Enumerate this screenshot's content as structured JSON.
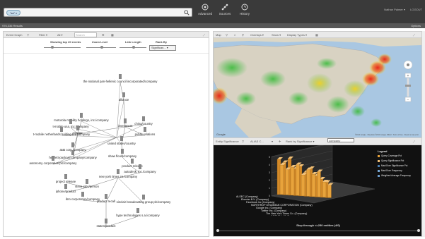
{
  "topbar": {
    "search_token": "\"sa\" x",
    "tools": [
      {
        "label": "Advanced",
        "icon": "gear-icon"
      },
      {
        "label": "Sources",
        "icon": "sources-icon"
      },
      {
        "label": "History",
        "icon": "history-icon"
      }
    ],
    "user_name": "Nathan Palmer ▾",
    "user_extra": "LOGOUT"
  },
  "subbar": {
    "results": "976,336 Results",
    "options": "Options"
  },
  "graph_panel": {
    "title": "Event Graph",
    "filter_label": "Filter ▾",
    "all_label": "All ▾",
    "search_placeholder": "Search",
    "showing_label": "Showing top 20 events",
    "zoom_label": "Zoom Level",
    "link_label": "Link Length",
    "rank_label": "Rank By",
    "rank_value": "Significan... ▾",
    "nodes": [
      "the national pan-hellenic council incorporated/company",
      "alliance",
      "motorola mobility holdings, inc./company",
      "t-mobile usa, inc./company",
      "t-mobile netherlands holding b.v./company",
      "china/country",
      "public relations",
      "united states/country",
      "at&t corp./company",
      "hewlett-packard company/company",
      "autonomy corporation plc/company",
      "shaw floors/company",
      "product release",
      "autodesk, inc./company",
      "project release",
      "iphone/product",
      "steve jobs/person",
      "ibm corporation/company",
      "product recall",
      "sinclair broadcasting group plc/company",
      "hype technologies s.a./company",
      "states/product",
      "new york times co./company",
      "merger",
      "investment"
    ]
  },
  "map_panel": {
    "title": "Map",
    "overlays": "Overlays ▾",
    "show": "Show ▾",
    "display_types": "Display Types ▾",
    "attribution": "©2014 Google · Map data ©2014 Google, INEGI · Terms of Use · Report a map error"
  },
  "chart_panel": {
    "title": "Entity Significance",
    "alias": "ALIAS C...",
    "rank_by": "Rank by Significance ▾",
    "company_input": "company",
    "step_text": "Step through <=250 entities (4/0)",
    "legend_title": "Legend",
    "legend": [
      {
        "label": "Query Coverage Pct",
        "color": "#e8a33b"
      },
      {
        "label": "Query Significance Pct",
        "color": "#f0c078"
      },
      {
        "label": "Max/Over Significance Pct",
        "color": "#4a7fb5"
      },
      {
        "label": "Max/Over Frequency",
        "color": "#7aa9d6"
      },
      {
        "label": "Weighted Average Frequency",
        "color": "#6d9ecf"
      }
    ],
    "entities": [
      "ALSEC (Company)",
      "Elsevier B.V. (Company)",
      "Facebook Inc (Company)",
      "NORTHROP GRUMMAN CORPORATION (Company)",
      "Google Inc. (Company)",
      "Twitter Inc. (Company)",
      "The New York Times Co. (Company)",
      "WEBMD LLC (Company)",
      "Apple Inc. (Company)",
      "THE BOEING COMPANY (Company)"
    ],
    "y_ticks": [
      "0",
      "1",
      "2",
      "3",
      "4",
      "5"
    ]
  }
}
